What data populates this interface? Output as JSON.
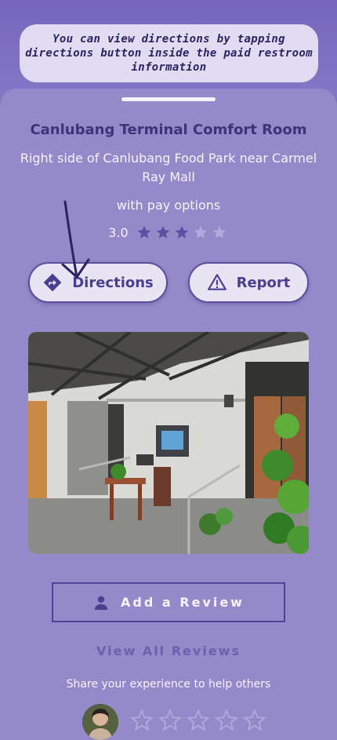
{
  "tooltip": {
    "text": "You can view directions by tapping directions button inside the paid restroom information"
  },
  "place": {
    "name": "Canlubang Terminal Comfort Room",
    "address": "Right side of Canlubang Food Park near Carmel Ray Mall",
    "payment": "with pay options",
    "rating_value": "3.0",
    "rating": 3,
    "rating_max": 5
  },
  "actions": {
    "directions_label": "Directions",
    "report_label": "Report"
  },
  "photo": {
    "icon": "restroom-photo"
  },
  "reviews": {
    "add_label": "Add a Review",
    "view_all_label": "View All Reviews",
    "share_prompt": "Share your experience to help others",
    "input_stars": 5
  },
  "colors": {
    "header": "#7a6bbf",
    "sheet": "#9489c9",
    "accent": "#4a3e91",
    "star_filled": "#5b4fa3",
    "star_empty": "#b2a9dc"
  }
}
